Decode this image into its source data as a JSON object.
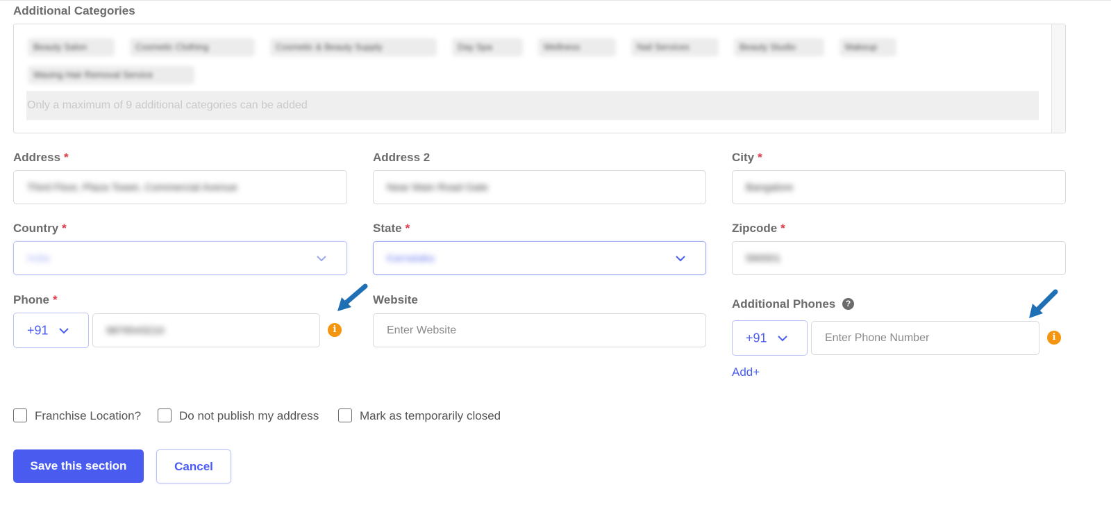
{
  "additional_categories": {
    "label": "Additional Categories",
    "chips": [
      "Beauty Salon",
      "Cosmetic Clothing",
      "Cosmetic & Beauty Supply",
      "Day Spa",
      "Wellness",
      "Nail Services",
      "Beauty Studio",
      "Makeup",
      "Waxing Hair Removal Service"
    ],
    "hint": "Only a maximum of 9 additional categories can be added"
  },
  "address": {
    "label": "Address",
    "value": "Third Floor, Plaza Tower, Commercial Avenue"
  },
  "address2": {
    "label": "Address 2",
    "value": "Near Main Road Gate"
  },
  "city": {
    "label": "City",
    "value": "Bangalore"
  },
  "country": {
    "label": "Country",
    "value": "India"
  },
  "state": {
    "label": "State",
    "value": "Karnataka"
  },
  "zipcode": {
    "label": "Zipcode",
    "value": "560001"
  },
  "phone": {
    "label": "Phone",
    "code": "+91",
    "value": "9876543210"
  },
  "website": {
    "label": "Website",
    "placeholder": "Enter Website"
  },
  "additional_phones": {
    "label": "Additional Phones",
    "code": "+91",
    "placeholder": "Enter Phone Number",
    "add_label": "Add+"
  },
  "checkboxes": [
    {
      "label": "Franchise Location?",
      "checked": false
    },
    {
      "label": "Do not publish my address",
      "checked": false
    },
    {
      "label": "Mark as temporarily closed",
      "checked": false
    }
  ],
  "actions": {
    "save_label": "Save this section",
    "cancel_label": "Cancel"
  },
  "required_marker": "*",
  "colors": {
    "accent": "#4a5cf0",
    "required": "#e0394a",
    "info": "#f5940f",
    "arrow": "#1f6fb5"
  }
}
